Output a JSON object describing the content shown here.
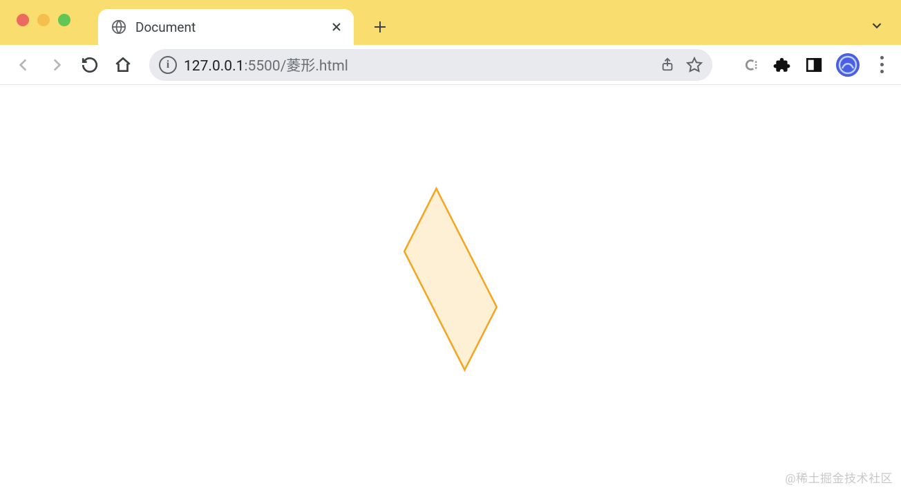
{
  "window": {
    "traffic_lights": {
      "close": "red",
      "minimize": "yellow",
      "maximize": "green"
    }
  },
  "tabs": [
    {
      "title": "Document",
      "favicon": "globe-icon"
    }
  ],
  "address": {
    "host": "127.0.0.1",
    "port_path": ":5500/菱形.html"
  },
  "page": {
    "shape": {
      "name": "diamond",
      "stroke": "#f4a623",
      "fill": "#fdf0d5"
    }
  },
  "watermark": "@稀土掘金技术社区"
}
